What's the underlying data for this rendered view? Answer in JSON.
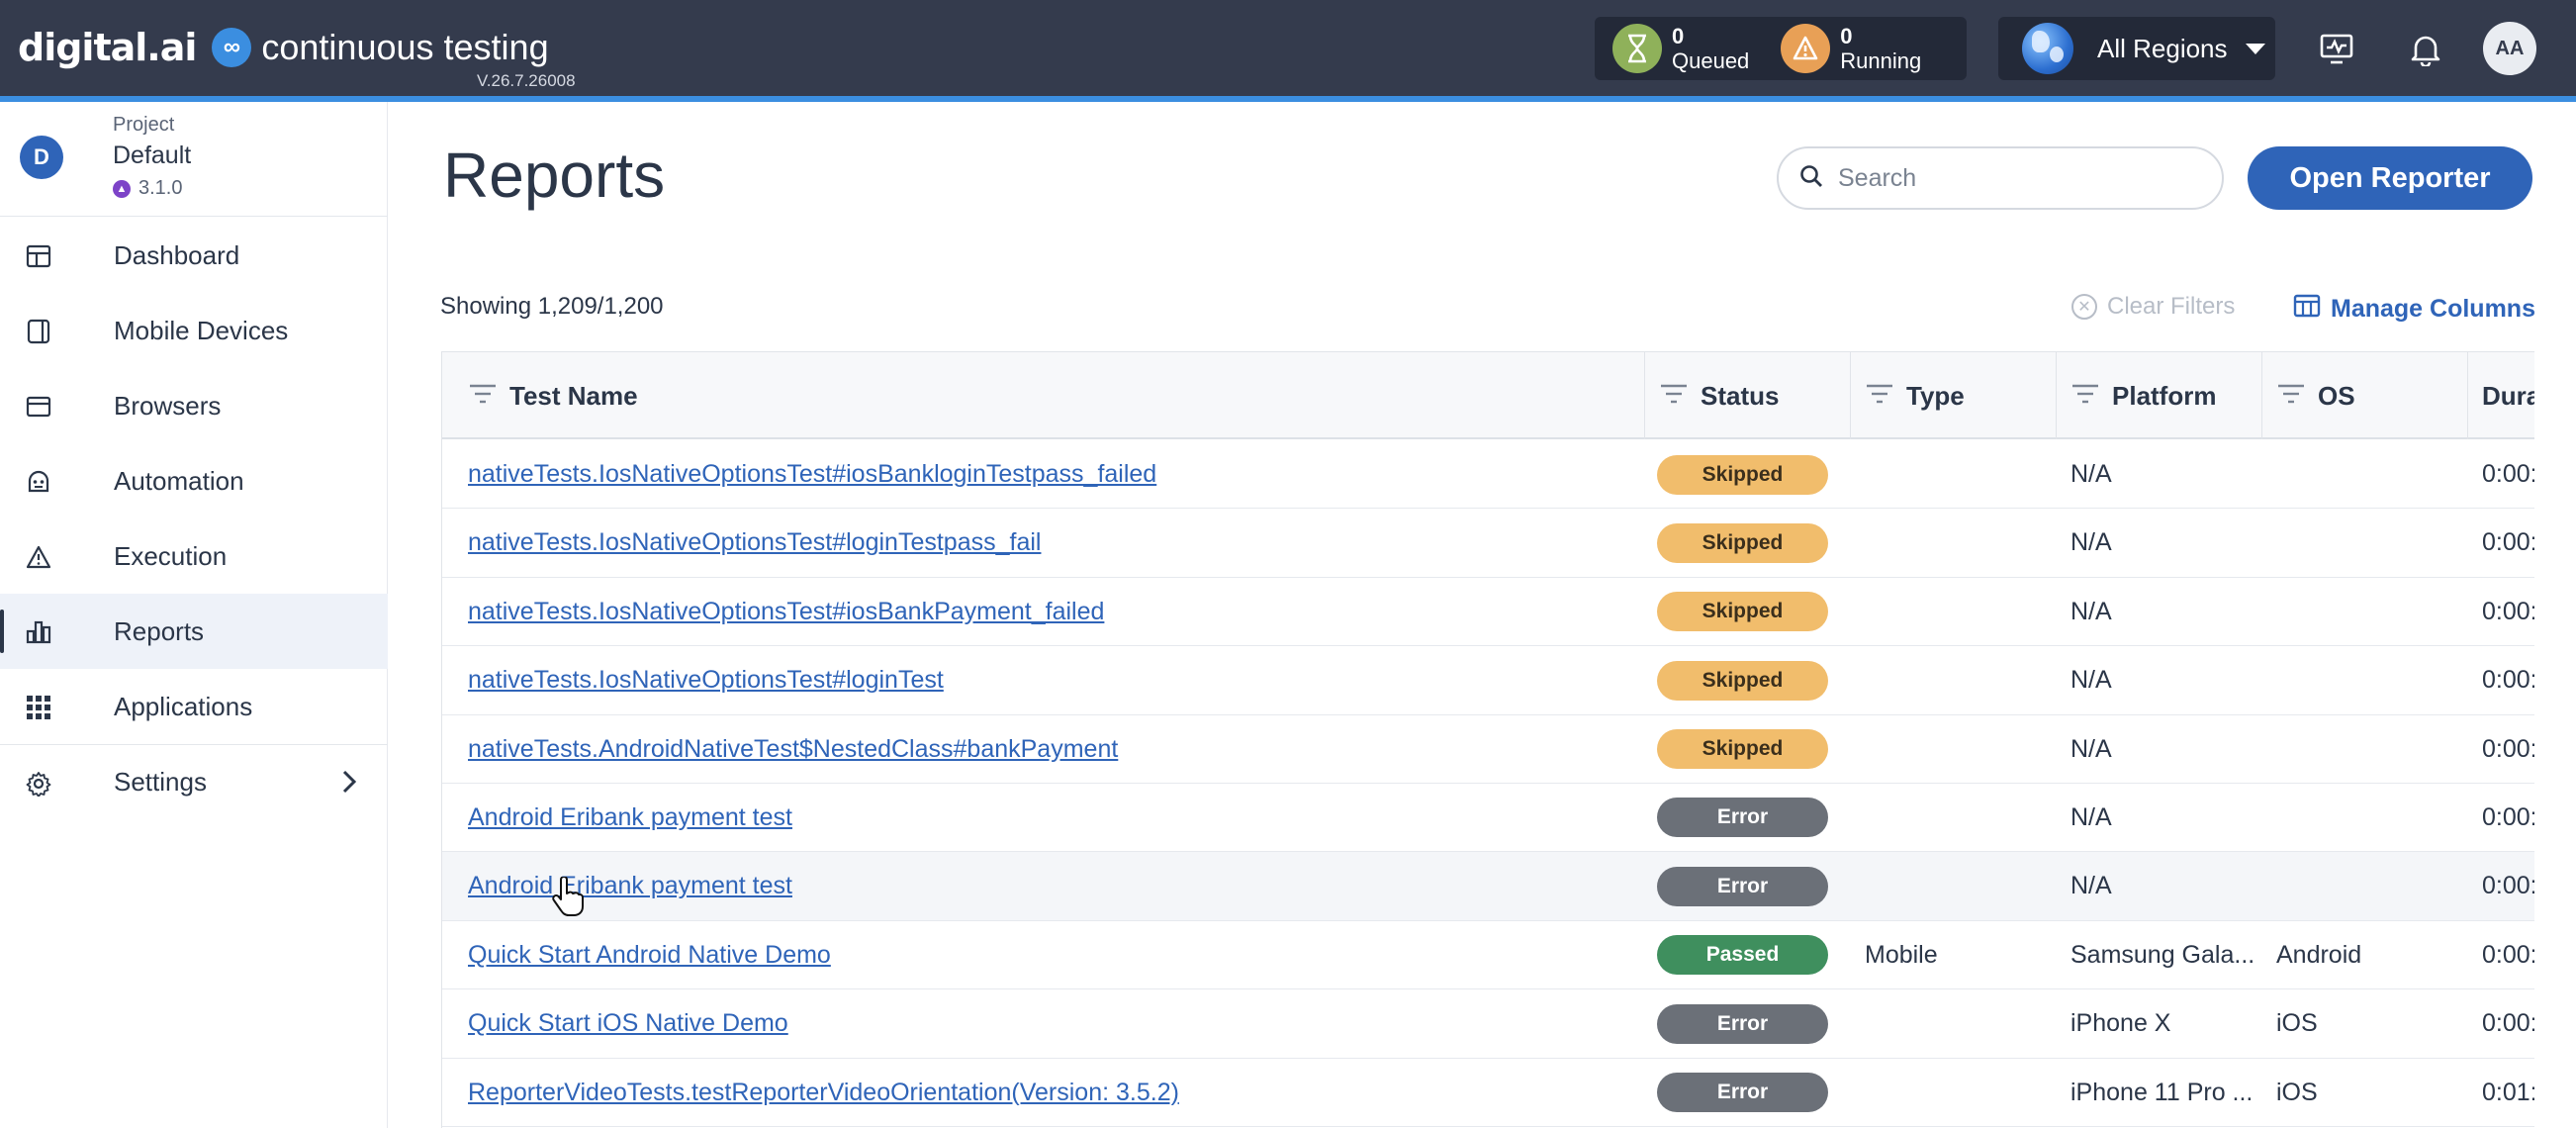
{
  "header": {
    "brand_logo": "digital.ai",
    "brand_icon": "∞",
    "product": "continuous testing",
    "version": "V.26.7.26008",
    "queued": {
      "count": "0",
      "label": "Queued",
      "icon": "hourglass-icon",
      "color": "#8fb15a"
    },
    "running": {
      "count": "0",
      "label": "Running",
      "icon": "alert-bell-icon",
      "color": "#e8a056"
    },
    "region": "All Regions",
    "user_initials": "AA",
    "accent_color": "#3b8ee0",
    "bar_color": "#343b4d"
  },
  "project": {
    "avatar": "D",
    "caption": "Project",
    "name": "Default",
    "version": "3.1.0"
  },
  "nav": {
    "items": [
      {
        "label": "Dashboard",
        "icon": "dashboard-icon"
      },
      {
        "label": "Mobile Devices",
        "icon": "mobile-device-icon"
      },
      {
        "label": "Browsers",
        "icon": "browser-icon"
      },
      {
        "label": "Automation",
        "icon": "automation-icon"
      },
      {
        "label": "Execution",
        "icon": "execution-icon"
      },
      {
        "label": "Reports",
        "icon": "reports-icon",
        "active": true
      },
      {
        "label": "Applications",
        "icon": "applications-grid-icon"
      },
      {
        "label": "Settings",
        "icon": "gear-icon"
      }
    ]
  },
  "main": {
    "title": "Reports",
    "search_placeholder": "Search",
    "open_reporter": "Open Reporter",
    "showing": "Showing 1,209/1,200",
    "clear_filters": "Clear Filters",
    "manage_columns": "Manage Columns",
    "primary_color": "#2f64b8"
  },
  "table": {
    "columns": [
      "Test Name",
      "Status",
      "Type",
      "Platform",
      "OS",
      "Dura"
    ],
    "rows": [
      {
        "name": "nativeTests.IosNativeOptionsTest#iosBankloginTestpass_failed",
        "status": "Skipped",
        "type": "",
        "platform": "N/A",
        "os": "",
        "duration": "0:00:"
      },
      {
        "name": "nativeTests.IosNativeOptionsTest#loginTestpass_fail",
        "status": "Skipped",
        "type": "",
        "platform": "N/A",
        "os": "",
        "duration": "0:00:"
      },
      {
        "name": "nativeTests.IosNativeOptionsTest#iosBankPayment_failed",
        "status": "Skipped",
        "type": "",
        "platform": "N/A",
        "os": "",
        "duration": "0:00:"
      },
      {
        "name": "nativeTests.IosNativeOptionsTest#loginTest",
        "status": "Skipped",
        "type": "",
        "platform": "N/A",
        "os": "",
        "duration": "0:00:"
      },
      {
        "name": "nativeTests.AndroidNativeTest$NestedClass#bankPayment",
        "status": "Skipped",
        "type": "",
        "platform": "N/A",
        "os": "",
        "duration": "0:00:"
      },
      {
        "name": "Android Eribank payment test",
        "status": "Error",
        "type": "",
        "platform": "N/A",
        "os": "",
        "duration": "0:00:"
      },
      {
        "name": "Android Eribank payment test",
        "status": "Error",
        "type": "",
        "platform": "N/A",
        "os": "",
        "duration": "0:00:",
        "hover": true
      },
      {
        "name": "Quick Start Android Native Demo",
        "status": "Passed",
        "type": "Mobile",
        "platform": "Samsung Gala...",
        "os": "Android",
        "duration": "0:00:"
      },
      {
        "name": "Quick Start iOS Native Demo",
        "status": "Error",
        "type": "",
        "platform": "iPhone X",
        "os": "iOS",
        "duration": "0:00:"
      },
      {
        "name": "ReporterVideoTests.testReporterVideoOrientation(Version: 3.5.2)",
        "status": "Error",
        "type": "",
        "platform": "iPhone 11 Pro ...",
        "os": "iOS",
        "duration": "0:01:"
      }
    ],
    "status_colors": {
      "Skipped": "#f1bd6c",
      "Error": "#6b7078",
      "Passed": "#3f8f5e"
    }
  }
}
